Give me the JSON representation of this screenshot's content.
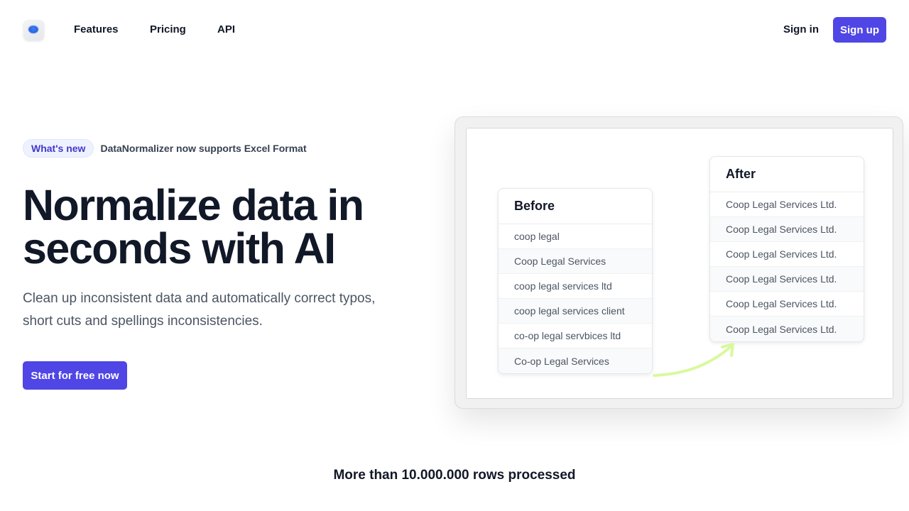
{
  "nav": {
    "links": [
      "Features",
      "Pricing",
      "API"
    ],
    "signin": "Sign in",
    "signup": "Sign up"
  },
  "hero": {
    "badge": "What's new",
    "badge_text": "DataNormalizer now supports Excel Format",
    "headline_line1": "Normalize data in",
    "headline_line2": "seconds with AI",
    "subtext_line1": "Clean up inconsistent data and automatically correct typos,",
    "subtext_line2": "short cuts and spellings inconsistencies.",
    "cta": "Start for free now"
  },
  "showcase": {
    "before": {
      "title": "Before",
      "rows": [
        "coop legal",
        "Coop Legal Services",
        "coop legal services ltd",
        "coop legal services client",
        "co-op legal servbices ltd",
        "Co-op Legal Services"
      ]
    },
    "after": {
      "title": "After",
      "rows": [
        "Coop Legal Services Ltd.",
        "Coop Legal Services Ltd.",
        "Coop Legal Services Ltd.",
        "Coop Legal Services Ltd.",
        "Coop Legal Services Ltd.",
        "Coop Legal Services Ltd."
      ]
    },
    "arrow_color": "#d9f99d"
  },
  "stat": "More than 10.000.000 rows processed",
  "colors": {
    "accent": "#4f46e5",
    "badge_bg": "#eef2ff"
  }
}
